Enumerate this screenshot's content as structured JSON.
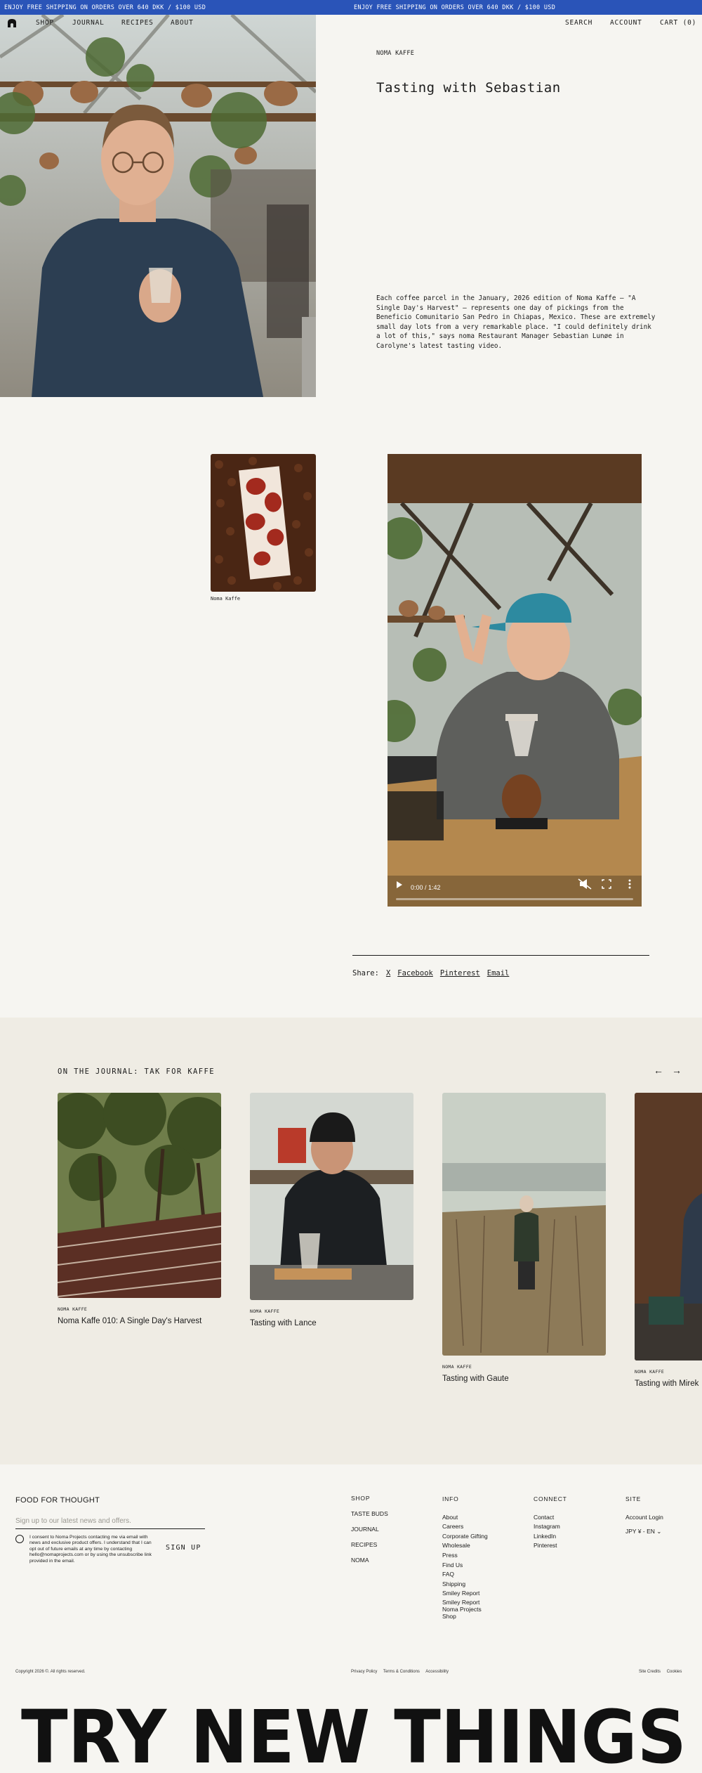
{
  "announcement": {
    "left": "ENJOY FREE SHIPPING ON ORDERS OVER 640 DKK / $100 USD",
    "right": "ENJOY FREE SHIPPING ON ORDERS OVER 640 DKK / $100 USD"
  },
  "nav": {
    "shop": "SHOP",
    "journal": "JOURNAL",
    "recipes": "RECIPES",
    "about": "ABOUT",
    "search": "SEARCH",
    "account": "ACCOUNT",
    "cart": "CART (0)"
  },
  "hero": {
    "kicker": "NOMA KAFFE",
    "title": "Tasting with Sebastian",
    "description": "Each coffee parcel in the January, 2026 edition of Noma Kaffe – \"A Single Day's Harvest\" – represents one day of pickings from the Beneficio Comunitario San Pedro in Chiapas, Mexico. These are extremely small day lots from a very remarkable place. \"I could definitely drink a lot of this,\" says noma Restaurant Manager Sebastian Lunøe in Carolyne's latest tasting video."
  },
  "product": {
    "caption": "Noma Kaffe"
  },
  "video": {
    "time": "0:00 / 1:42"
  },
  "share": {
    "label": "Share:",
    "x": "X",
    "facebook": "Facebook",
    "pinterest": "Pinterest",
    "email": "Email"
  },
  "journal": {
    "title": "ON THE JOURNAL: TAK FOR KAFFE",
    "cards": [
      {
        "kicker": "NOMA KAFFE",
        "title": "Noma Kaffe 010: A Single Day's Harvest"
      },
      {
        "kicker": "NOMA KAFFE",
        "title": "Tasting with Lance"
      },
      {
        "kicker": "NOMA KAFFE",
        "title": "Tasting with Gaute"
      },
      {
        "kicker": "NOMA KAFFE",
        "title": "Tasting with Mirek"
      }
    ]
  },
  "footer": {
    "heading": "FOOD FOR THOUGHT",
    "placeholder": "Sign up to our latest news and offers.",
    "consent": "I consent to Noma Projects contacting me via email with news and exclusive product offers. I understand that I can opt out of future emails at any time by contacting hello@nomaprojects.com or by using the unsubscribe link provided in the email.",
    "signup": "SIGN UP",
    "shop": {
      "heading": "SHOP",
      "items": [
        "TASTE BUDS",
        "JOURNAL",
        "RECIPES",
        "NOMA"
      ]
    },
    "info": {
      "heading": "INFO",
      "items": [
        "About",
        "Careers",
        "Corporate Gifting",
        "Wholesale",
        "Press",
        "Find Us",
        "FAQ",
        "Shipping",
        "Smiley Report",
        "Smiley Report Noma Projects Shop"
      ]
    },
    "connect": {
      "heading": "CONNECT",
      "items": [
        "Contact",
        "Instagram",
        "LinkedIn",
        "Pinterest"
      ]
    },
    "site": {
      "heading": "SITE",
      "items": [
        "Account Login",
        "JPY ¥ - EN"
      ]
    },
    "copyright": "Copyright 2026 ©. All rights reserved.",
    "legal": [
      "Privacy Policy",
      "Terms & Conditions",
      "Accessibility"
    ],
    "credits": [
      "Site Credits",
      "Cookies"
    ],
    "slogan": "TRY NEW THINGS"
  }
}
